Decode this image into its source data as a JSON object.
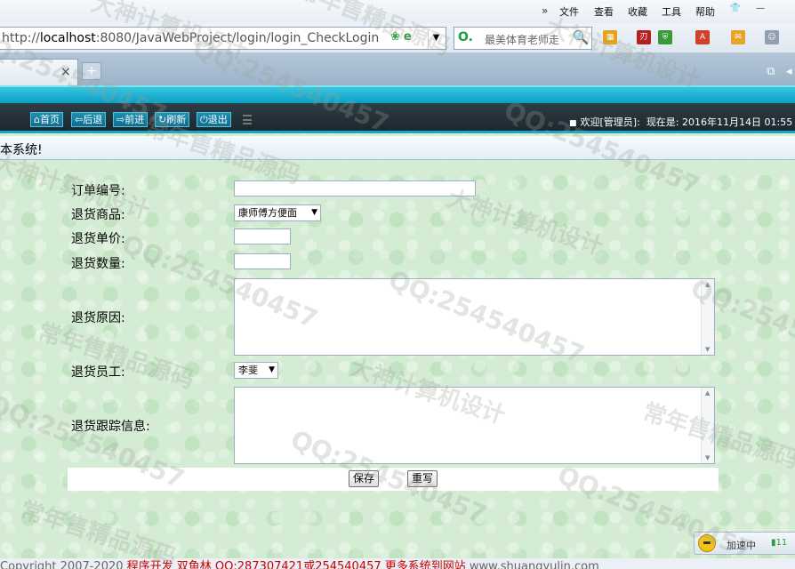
{
  "browser": {
    "menu": {
      "chevron": "»",
      "file": "文件",
      "view": "查看",
      "favorites": "收藏",
      "tools": "工具",
      "help": "帮助"
    },
    "address": {
      "prefix": "http://",
      "host": "localhost",
      "path": ":8080/JavaWebProject/login/login_CheckLogin"
    },
    "search": {
      "placeholder": "最美体育老师走"
    },
    "tab": {
      "close": "×",
      "new": "+"
    }
  },
  "nav": {
    "home": "首页",
    "back": "后退",
    "forward": "前进",
    "refresh": "刷新",
    "logout": "退出",
    "welcome": "欢迎[管理员]:",
    "datetime_label": "现在是:",
    "datetime": "2016年11月14日 01:55"
  },
  "system_text": "本系统!",
  "form": {
    "order_no_label": "订单编号:",
    "order_no_value": "",
    "product_label": "退货商品:",
    "product_value": "康师傅方便面",
    "price_label": "退货单价:",
    "price_value": "",
    "quantity_label": "退货数量:",
    "quantity_value": "",
    "reason_label": "退货原因:",
    "reason_value": "",
    "employee_label": "退货员工:",
    "employee_value": "李斐",
    "tracking_label": "退货跟踪信息:",
    "tracking_value": "",
    "save": "保存",
    "reset": "重写"
  },
  "status": {
    "prefix": "Copyright 2007-2020",
    "text": "  程序开发 双鱼林  QQ:287307421或254540457  更多系统到网站",
    "suffix": " www.shuangyulin.com"
  },
  "speed": {
    "label": "加速中",
    "value": "11"
  },
  "watermarks": {
    "a": "常年售精品源码",
    "b": "QQ:254540457",
    "c": "大神计算机设计"
  }
}
